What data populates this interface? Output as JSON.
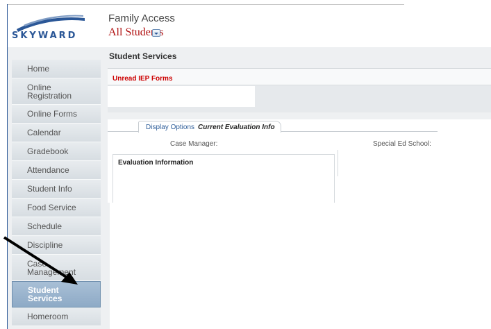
{
  "header": {
    "brand": "SKYWARD",
    "app_title": "Family Access",
    "student_selector": "All Students"
  },
  "sidebar": {
    "items": [
      {
        "label": "Home"
      },
      {
        "label": "Online\nRegistration"
      },
      {
        "label": "Online Forms"
      },
      {
        "label": "Calendar"
      },
      {
        "label": "Gradebook"
      },
      {
        "label": "Attendance"
      },
      {
        "label": "Student Info"
      },
      {
        "label": "Food Service"
      },
      {
        "label": "Schedule"
      },
      {
        "label": "Discipline"
      },
      {
        "label": "Case\nManagement"
      },
      {
        "label": "Student\nServices"
      },
      {
        "label": "Homeroom"
      }
    ],
    "active_index": 11
  },
  "main": {
    "title": "Student Services",
    "iep_title": "Unread IEP Forms",
    "tabs": {
      "link": "Display Options",
      "current": "Current Evaluation Info"
    },
    "case_manager_label": "Case Manager:",
    "special_ed_label": "Special Ed School:",
    "evaluation_title": "Evaluation Information"
  },
  "colors": {
    "brand_blue": "#2b5797",
    "alert_red": "#cc0000",
    "selector_red": "#b01010",
    "active_nav": "#8eaac6"
  }
}
